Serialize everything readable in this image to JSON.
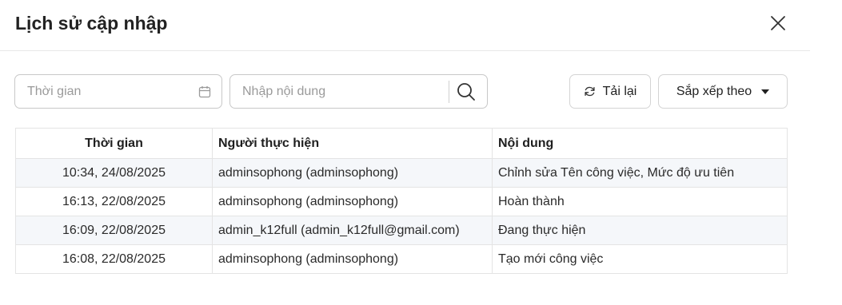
{
  "dialog": {
    "title": "Lịch sử cập nhập"
  },
  "toolbar": {
    "date_placeholder": "Thời gian",
    "search_placeholder": "Nhập nội dung",
    "reload_label": "Tải lại",
    "sort_label": "Sắp xếp theo"
  },
  "table": {
    "headers": {
      "time": "Thời gian",
      "user": "Người thực hiện",
      "content": "Nội dung"
    },
    "rows": [
      {
        "time": "10:34, 24/08/2025",
        "user": "adminsophong (adminsophong)",
        "content": "Chỉnh sửa Tên công việc, Mức độ ưu tiên"
      },
      {
        "time": "16:13, 22/08/2025",
        "user": "adminsophong (adminsophong)",
        "content": "Hoàn thành"
      },
      {
        "time": "16:09, 22/08/2025",
        "user": "admin_k12full (admin_k12full@gmail.com)",
        "content": "Đang thực hiện"
      },
      {
        "time": "16:08, 22/08/2025",
        "user": "adminsophong (adminsophong)",
        "content": "Tạo mới công việc"
      }
    ]
  },
  "icons": {
    "close": "close-icon",
    "calendar": "calendar-icon",
    "search": "search-icon",
    "reload": "reload-icon",
    "sort_caret": "caret-down-icon"
  },
  "colors": {
    "border": "#c8c8c8",
    "row_stripe": "#f5f7fa"
  }
}
